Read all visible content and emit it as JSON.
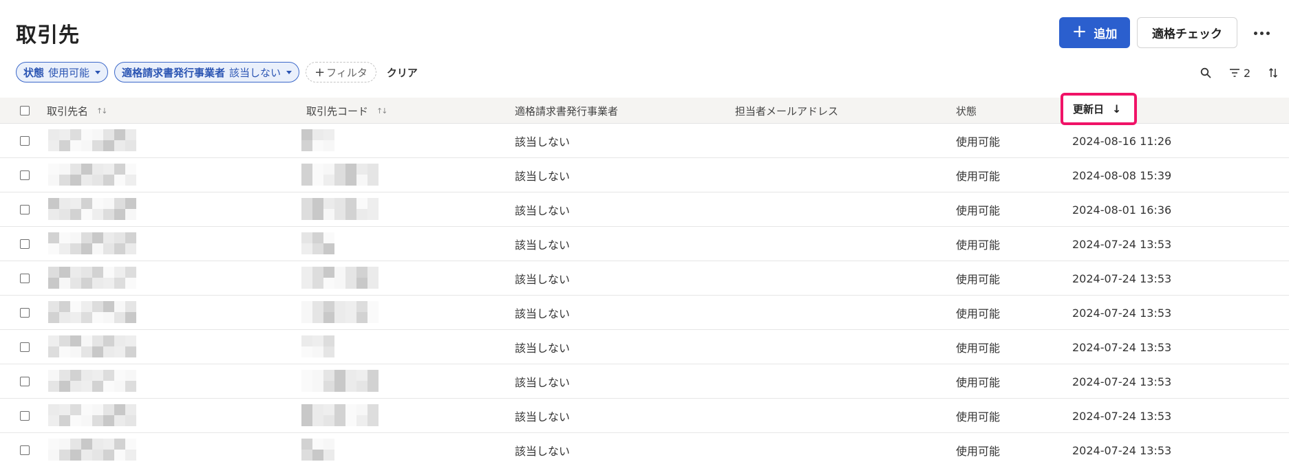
{
  "header": {
    "title": "取引先",
    "add_label": "追加",
    "check_label": "適格チェック"
  },
  "filters": [
    {
      "key": "状態",
      "value": "使用可能"
    },
    {
      "key": "適格請求書発行事業者",
      "value": "該当しない"
    }
  ],
  "filter_add_label": "フィルタ",
  "clear_label": "クリア",
  "toolbar": {
    "filter_count": "2"
  },
  "columns": {
    "name": "取引先名",
    "code": "取引先コード",
    "qualified": "適格請求書発行事業者",
    "email": "担当者メールアドレス",
    "status": "状態",
    "updated": "更新日"
  },
  "rows": [
    {
      "qualified": "該当しない",
      "status": "使用可能",
      "updated": "2024-08-16 11:26"
    },
    {
      "qualified": "該当しない",
      "status": "使用可能",
      "updated": "2024-08-08 15:39"
    },
    {
      "qualified": "該当しない",
      "status": "使用可能",
      "updated": "2024-08-01 16:36"
    },
    {
      "qualified": "該当しない",
      "status": "使用可能",
      "updated": "2024-07-24 13:53"
    },
    {
      "qualified": "該当しない",
      "status": "使用可能",
      "updated": "2024-07-24 13:53"
    },
    {
      "qualified": "該当しない",
      "status": "使用可能",
      "updated": "2024-07-24 13:53"
    },
    {
      "qualified": "該当しない",
      "status": "使用可能",
      "updated": "2024-07-24 13:53"
    },
    {
      "qualified": "該当しない",
      "status": "使用可能",
      "updated": "2024-07-24 13:53"
    },
    {
      "qualified": "該当しない",
      "status": "使用可能",
      "updated": "2024-07-24 13:53"
    },
    {
      "qualified": "該当しない",
      "status": "使用可能",
      "updated": "2024-07-24 13:53"
    }
  ],
  "colors": {
    "accent": "#2b5fce",
    "highlight": "#f01367",
    "header_bg": "#f5f4f2"
  }
}
